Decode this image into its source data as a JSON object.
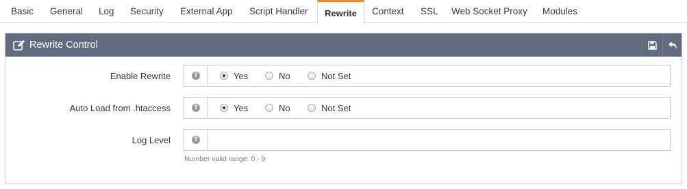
{
  "tabs": [
    {
      "label": "Basic"
    },
    {
      "label": "General"
    },
    {
      "label": "Log"
    },
    {
      "label": "Security"
    },
    {
      "label": "External App"
    },
    {
      "label": "Script Handler"
    },
    {
      "label": "Rewrite",
      "active": true
    },
    {
      "label": "Context"
    },
    {
      "label": "SSL"
    },
    {
      "label": "Web Socket Proxy"
    },
    {
      "label": "Modules"
    }
  ],
  "panel": {
    "title": "Rewrite Control",
    "title_icon": "edit-icon",
    "save_icon": "save-icon",
    "back_icon": "undo-icon"
  },
  "fields": {
    "enable_rewrite": {
      "label": "Enable Rewrite",
      "options": [
        "Yes",
        "No",
        "Not Set"
      ],
      "selected": "Yes"
    },
    "auto_load": {
      "label": "Auto Load from .htaccess",
      "options": [
        "Yes",
        "No",
        "Not Set"
      ],
      "selected": "Yes"
    },
    "log_level": {
      "label": "Log Level",
      "value": "",
      "hint": "Number valid range: 0 - 9"
    }
  },
  "help_symbol": "?",
  "colors": {
    "header_bg": "#626b7e",
    "active_tab_accent": "#f08a2a"
  }
}
